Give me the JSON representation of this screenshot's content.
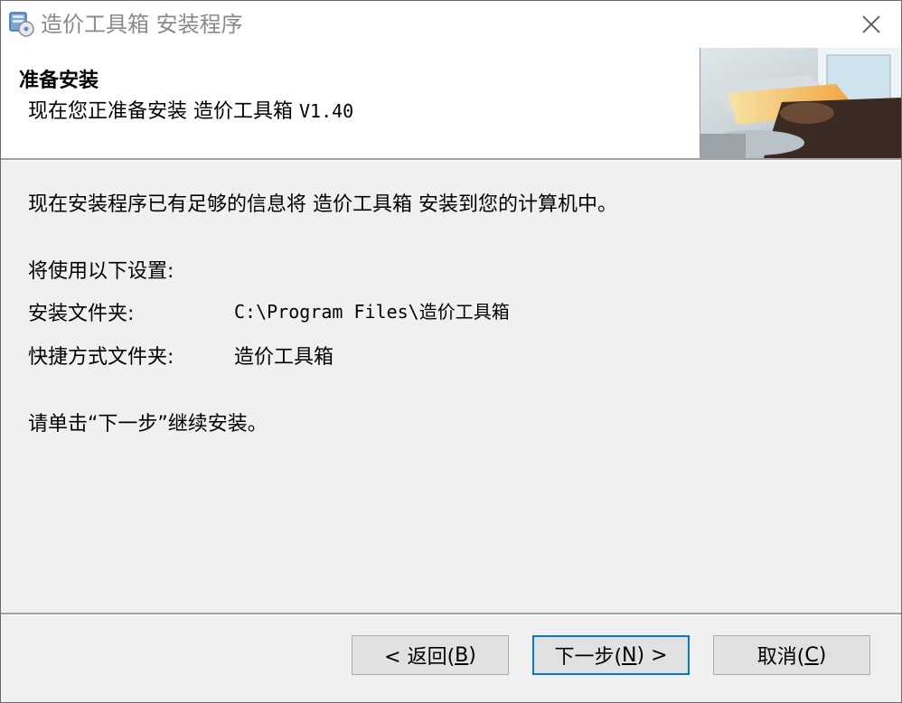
{
  "window": {
    "title": "造价工具箱 安装程序",
    "close_label": "×"
  },
  "header": {
    "title": "准备安装",
    "subtitle_prefix": "现在您正准备安装 造价工具箱 ",
    "subtitle_version": "V1.40"
  },
  "body": {
    "info_text": "现在安装程序已有足够的信息将 造价工具箱 安装到您的计算机中。",
    "settings_heading": "将使用以下设置:",
    "install_folder_label": "安装文件夹:",
    "install_folder_value": "C:\\Program Files\\造价工具箱",
    "shortcut_folder_label": "快捷方式文件夹:",
    "shortcut_folder_value": "造价工具箱",
    "continue_text": "请单击“下一步”继续安装。"
  },
  "buttons": {
    "back": {
      "before": "< 返回(",
      "key": "B",
      "after": ")"
    },
    "next": {
      "before": "下一步(",
      "key": "N",
      "after": ") >"
    },
    "cancel": {
      "before": "取消(",
      "key": "C",
      "after": ")"
    }
  },
  "colors": {
    "title_text": "#8a8a8a",
    "default_button_border": "#0078d7",
    "button_face": "#e1e1e1"
  }
}
